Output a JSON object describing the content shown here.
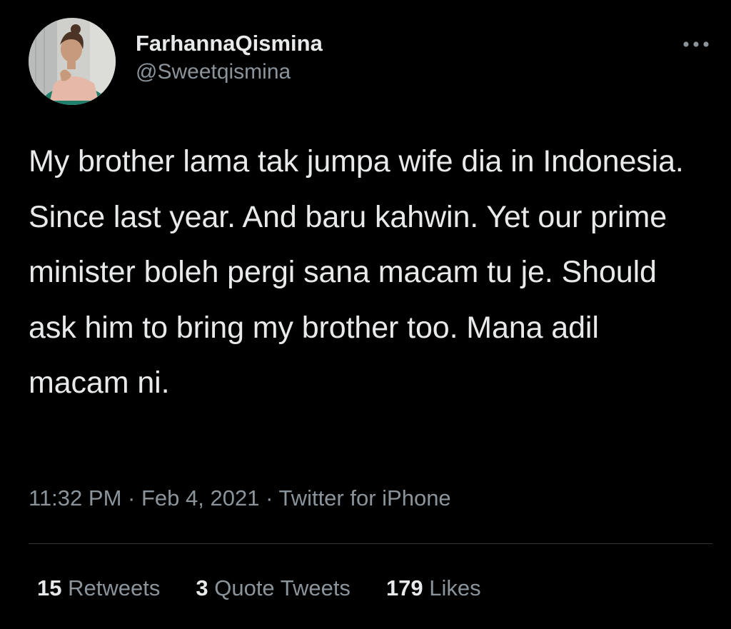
{
  "author": {
    "display_name": "FarhannaQismina",
    "handle": "@Sweetqismina"
  },
  "tweet": {
    "text": "My brother lama tak jumpa wife dia in Indonesia. Since last year. And baru kahwin. Yet our prime minister boleh pergi sana macam tu je. Should ask him to bring my brother too. Mana adil macam ni."
  },
  "meta": {
    "time": "11:32 PM",
    "separator": "·",
    "date": "Feb 4, 2021",
    "source": "Twitter for iPhone"
  },
  "stats": {
    "retweets": {
      "count": "15",
      "label": "Retweets"
    },
    "quote_tweets": {
      "count": "3",
      "label": "Quote Tweets"
    },
    "likes": {
      "count": "179",
      "label": "Likes"
    }
  },
  "icons": {
    "more": "more-horizontal-icon"
  },
  "colors": {
    "background": "#000000",
    "primary_text": "#e7e9ea",
    "secondary_text": "#8b949a",
    "divider": "#2f3336"
  }
}
